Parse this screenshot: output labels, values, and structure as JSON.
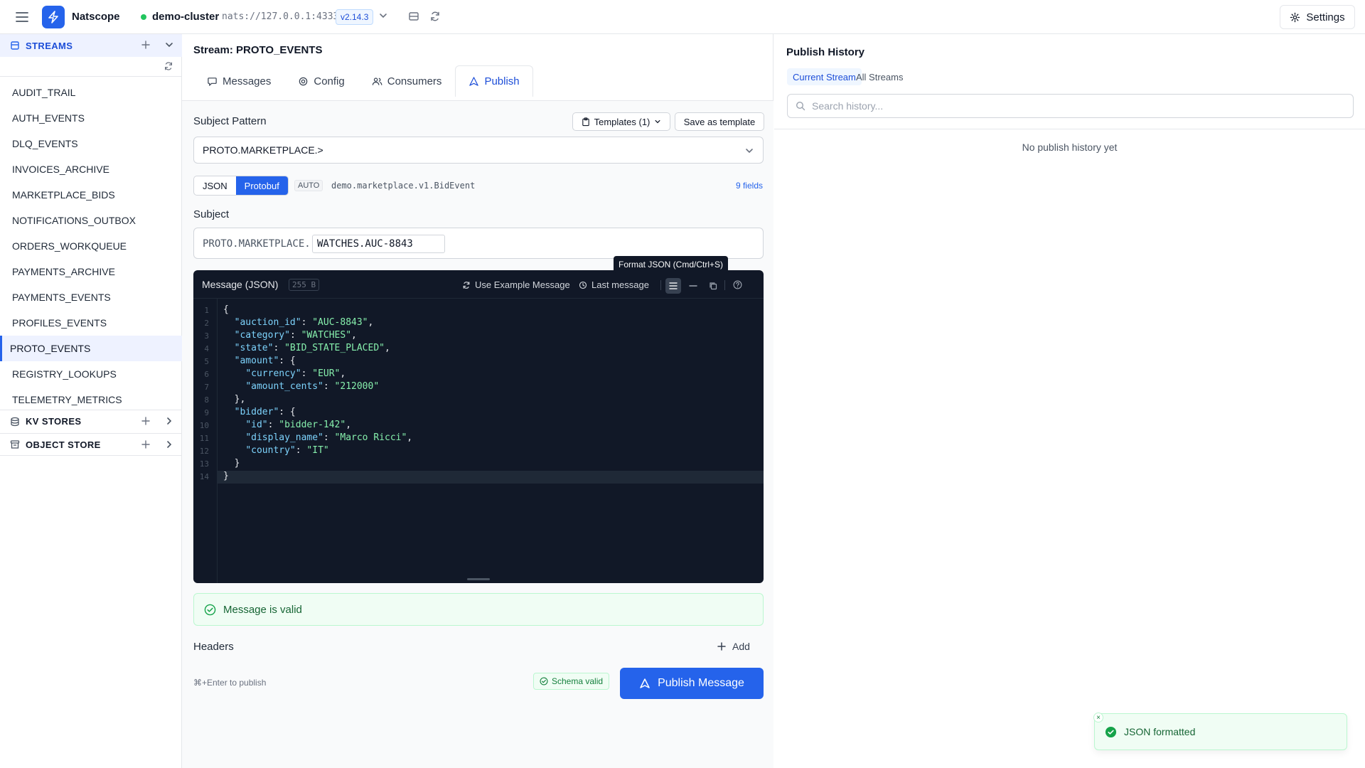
{
  "topbar": {
    "app_name": "Natscope",
    "cluster_name": "demo-cluster",
    "cluster_url": "nats://127.0.0.1:4333",
    "version": "v2.14.3",
    "settings_label": "Settings",
    "status_color": "#22c55e"
  },
  "sidebar": {
    "streams_label": "STREAMS",
    "streams": [
      {
        "label": "AUDIT_TRAIL"
      },
      {
        "label": "AUTH_EVENTS"
      },
      {
        "label": "DLQ_EVENTS"
      },
      {
        "label": "INVOICES_ARCHIVE"
      },
      {
        "label": "MARKETPLACE_BIDS"
      },
      {
        "label": "NOTIFICATIONS_OUTBOX"
      },
      {
        "label": "ORDERS_WORKQUEUE"
      },
      {
        "label": "PAYMENTS_ARCHIVE"
      },
      {
        "label": "PAYMENTS_EVENTS"
      },
      {
        "label": "PROFILES_EVENTS"
      },
      {
        "label": "PROTO_EVENTS"
      },
      {
        "label": "REGISTRY_LOOKUPS"
      },
      {
        "label": "TELEMETRY_METRICS"
      }
    ],
    "active_stream": "PROTO_EVENTS",
    "kv_label": "KV STORES",
    "object_label": "OBJECT STORE"
  },
  "main": {
    "stream_title": "Stream: PROTO_EVENTS",
    "tabs": [
      {
        "label": "Messages",
        "icon": "message-icon"
      },
      {
        "label": "Config",
        "icon": "gear-icon"
      },
      {
        "label": "Consumers",
        "icon": "users-icon"
      },
      {
        "label": "Publish",
        "icon": "send-icon"
      }
    ],
    "active_tab": "Publish",
    "subject_pattern_label": "Subject Pattern",
    "templates_button": "Templates (1)",
    "save_template_button": "Save as template",
    "subject_pattern_value": "PROTO.MARKETPLACE.>",
    "format_options": [
      "JSON",
      "Protobuf"
    ],
    "selected_format": "Protobuf",
    "auto_badge": "AUTO",
    "proto_type": "demo.marketplace.v1.BidEvent",
    "fields_link": "9 fields",
    "subject_label": "Subject",
    "subject_prefix": "PROTO.MARKETPLACE.",
    "subject_suffix": "WATCHES.AUC-8843",
    "tooltip": "Format JSON (Cmd/Ctrl+S)",
    "editor": {
      "title": "Message (JSON)",
      "size": "255 B",
      "use_example": "Use Example Message",
      "last_message": "Last message",
      "line_numbers": [
        "1",
        "2",
        "3",
        "4",
        "5",
        "6",
        "7",
        "8",
        "9",
        "10",
        "11",
        "12",
        "13",
        "14"
      ],
      "lines": [
        "{",
        "  \"auction_id\": \"AUC-8843\",",
        "  \"category\": \"WATCHES\",",
        "  \"state\": \"BID_STATE_PLACED\",",
        "  \"amount\": {",
        "    \"currency\": \"EUR\",",
        "    \"amount_cents\": \"212000\"",
        "  },",
        "  \"bidder\": {",
        "    \"id\": \"bidder-142\",",
        "    \"display_name\": \"Marco Ricci\",",
        "    \"country\": \"IT\"",
        "  }",
        "}"
      ]
    },
    "valid_message": "Message is valid",
    "headers_label": "Headers",
    "add_label": "Add",
    "shortcut_hint": "⌘+Enter to publish",
    "schema_badge": "Schema valid",
    "publish_button": "Publish Message"
  },
  "history": {
    "title": "Publish History",
    "tabs": [
      "Current Stream",
      "All Streams"
    ],
    "active_tab": "Current Stream",
    "search_placeholder": "Search history...",
    "empty_text": "No publish history yet"
  },
  "toast": {
    "message": "JSON formatted"
  },
  "colors": {
    "accent": "#2563eb",
    "success": "#16a34a",
    "editor_bg": "#111827"
  }
}
